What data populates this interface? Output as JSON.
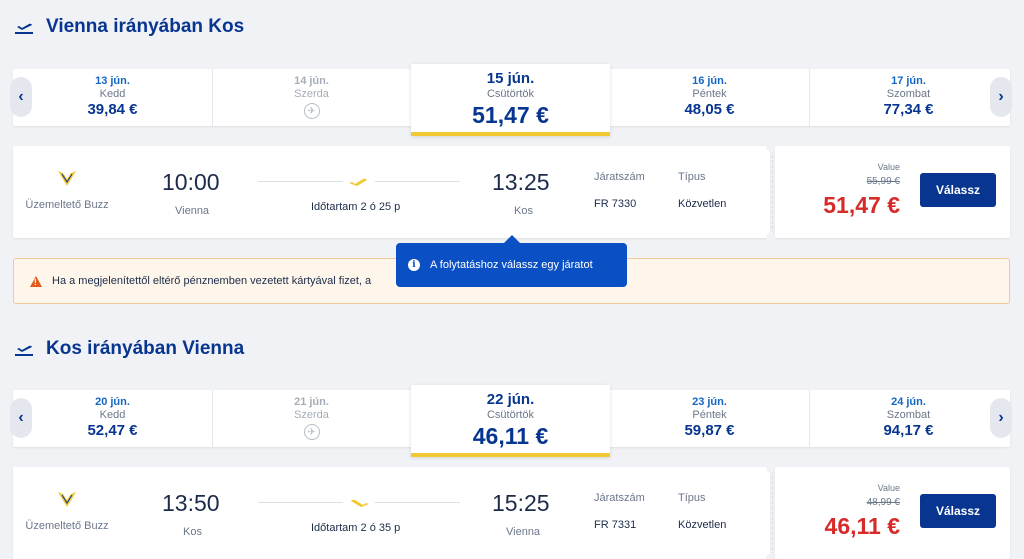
{
  "outbound": {
    "title": "Vienna irányában Kos",
    "dates": [
      {
        "date": "13 jún.",
        "weekday": "Kedd",
        "price": "39,84 €"
      },
      {
        "date": "14 jún.",
        "weekday": "Szerda",
        "price": ""
      },
      {
        "date": "15 jún.",
        "weekday": "Csütörtök",
        "price": "51,47 €"
      },
      {
        "date": "16 jún.",
        "weekday": "Péntek",
        "price": "48,05 €"
      },
      {
        "date": "17 jún.",
        "weekday": "Szombat",
        "price": "77,34 €"
      }
    ],
    "flight": {
      "operated_by": "Üzemeltető Buzz",
      "dep_time": "10:00",
      "dep_city": "Vienna",
      "duration": "Időtartam 2 ó 25 p",
      "arr_time": "13:25",
      "arr_city": "Kos",
      "flight_no_label": "Járatszám",
      "flight_no": "FR 7330",
      "type_label": "Típus",
      "type": "Közvetlen",
      "fare_name": "Value",
      "old_price": "55,99 €",
      "price": "51,47 €",
      "select_label": "Válassz"
    }
  },
  "warning_text": "Ha a megjelenítettől eltérő pénznemben vezetett kártyával fizet, a",
  "tooltip_text": "A folytatáshoz válassz egy járatot",
  "inbound": {
    "title": "Kos irányában Vienna",
    "dates": [
      {
        "date": "20 jún.",
        "weekday": "Kedd",
        "price": "52,47 €"
      },
      {
        "date": "21 jún.",
        "weekday": "Szerda",
        "price": ""
      },
      {
        "date": "22 jún.",
        "weekday": "Csütörtök",
        "price": "46,11 €"
      },
      {
        "date": "23 jún.",
        "weekday": "Péntek",
        "price": "59,87 €"
      },
      {
        "date": "24 jún.",
        "weekday": "Szombat",
        "price": "94,17 €"
      }
    ],
    "flight": {
      "operated_by": "Üzemeltető Buzz",
      "dep_time": "13:50",
      "dep_city": "Kos",
      "duration": "Időtartam 2 ó 35 p",
      "arr_time": "15:25",
      "arr_city": "Vienna",
      "flight_no_label": "Járatszám",
      "flight_no": "FR 7331",
      "type_label": "Típus",
      "type": "Közvetlen",
      "fare_name": "Value",
      "old_price": "48,99 €",
      "price": "46,11 €",
      "select_label": "Válassz"
    }
  },
  "colors": {
    "brand": "#073590",
    "accent": "#f1c933",
    "price_red": "#d72a2a",
    "tooltip": "#0a4fc4"
  }
}
